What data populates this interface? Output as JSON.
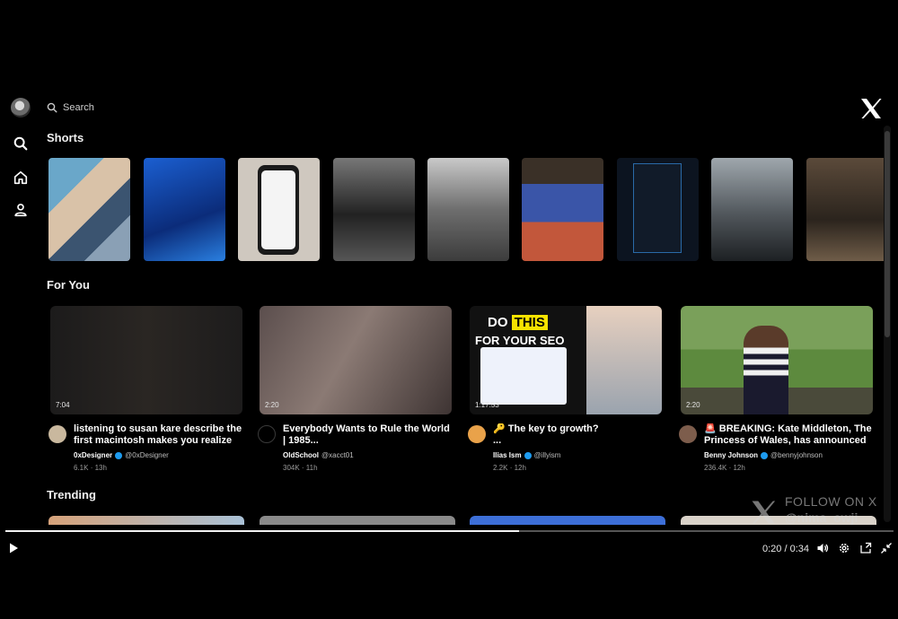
{
  "search": {
    "placeholder": "Search"
  },
  "sections": {
    "shorts": "Shorts",
    "for_you": "For You",
    "trending": "Trending"
  },
  "shorts": [
    {
      "name": "short-1"
    },
    {
      "name": "short-2"
    },
    {
      "name": "short-3"
    },
    {
      "name": "short-4"
    },
    {
      "name": "short-5"
    },
    {
      "name": "short-6"
    },
    {
      "name": "short-7"
    },
    {
      "name": "short-8"
    },
    {
      "name": "short-9"
    }
  ],
  "for_you": [
    {
      "duration": "7:04",
      "title": "listening to susan kare describe the first macintosh makes you realize ...",
      "author": "0xDesigner",
      "handle": "@0xDesigner",
      "views": "6.1K",
      "age": "13h"
    },
    {
      "duration": "2:20",
      "title": "Everybody Wants to Rule the World | 1985...",
      "author": "OldSchool",
      "handle": "@xacct01",
      "views": "304K",
      "age": "11h"
    },
    {
      "duration": "1:17:53",
      "title": "🔑 The key to growth?",
      "title_line2": "...",
      "author": "Ilias Ism",
      "handle": "@illyism",
      "views": "2.2K",
      "age": "12h",
      "thumb_text1": "DO",
      "thumb_text2": "THIS",
      "thumb_text3": "FOR YOUR SEO"
    },
    {
      "duration": "2:20",
      "title": "🚨 BREAKING: Kate Middleton, The Princess of Wales, has announced ...",
      "author": "Benny Johnson",
      "handle": "@bennyjohnson",
      "views": "236.4K",
      "age": "12h"
    }
  ],
  "watermark": {
    "follow": "FOLLOW ON X",
    "handle": "@nima_owji"
  },
  "player": {
    "time": "0:20 / 0:34",
    "progress": 0.578
  }
}
